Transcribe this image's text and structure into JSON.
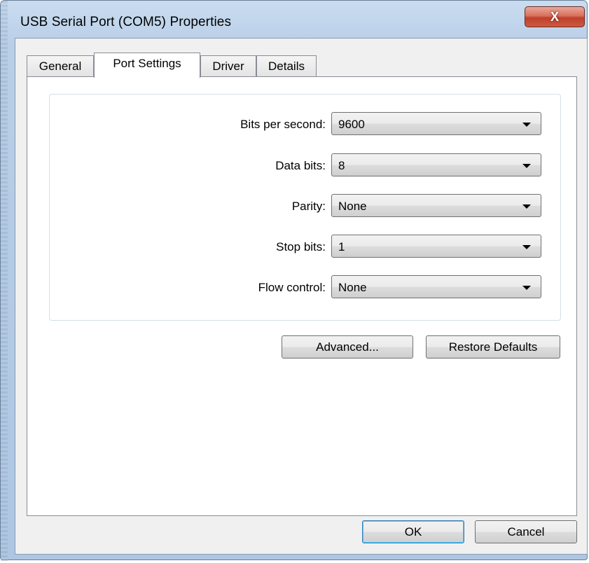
{
  "window": {
    "title": "USB Serial Port (COM5) Properties",
    "close_label": "X"
  },
  "tabs": [
    {
      "label": "General",
      "active": false
    },
    {
      "label": "Port Settings",
      "active": true
    },
    {
      "label": "Driver",
      "active": false
    },
    {
      "label": "Details",
      "active": false
    }
  ],
  "settings": [
    {
      "label": "Bits per second:",
      "value": "9600"
    },
    {
      "label": "Data bits:",
      "value": "8"
    },
    {
      "label": "Parity:",
      "value": "None"
    },
    {
      "label": "Stop bits:",
      "value": "1"
    },
    {
      "label": "Flow control:",
      "value": "None"
    }
  ],
  "panel_buttons": {
    "advanced": "Advanced...",
    "restore_defaults": "Restore Defaults"
  },
  "dialog_buttons": {
    "ok": "OK",
    "cancel": "Cancel"
  }
}
